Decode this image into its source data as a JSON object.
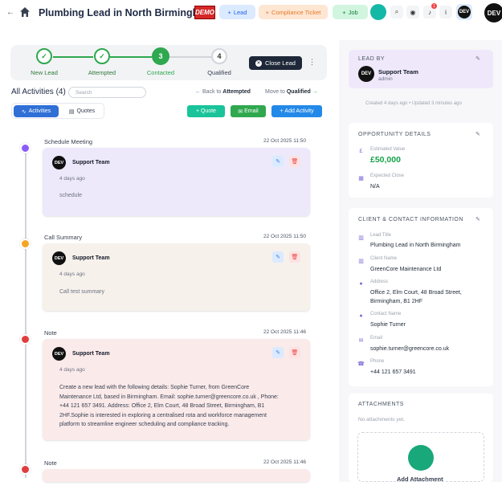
{
  "header": {
    "back_arrow": "←",
    "title": "Plumbing Lead in North Birmingh...",
    "demo_badge": "DEMO",
    "buttons": {
      "lead": "Lead",
      "compliance": "Compliance Ticket",
      "job": "Job"
    },
    "notification_count": "1",
    "avatar": "DEV"
  },
  "stepper": {
    "steps": [
      {
        "label": "New Lead",
        "state": "done"
      },
      {
        "label": "Attempted",
        "state": "done"
      },
      {
        "label": "Contacted",
        "number": "3",
        "state": "active"
      },
      {
        "label": "Qualified",
        "number": "4",
        "state": "next"
      }
    ],
    "close_lead": "Close Lead"
  },
  "activities": {
    "title": "All Activities (4)",
    "search_placeholder": "Search",
    "back_to_prefix": "Back to",
    "back_to_stage": "Attempted",
    "move_to_prefix": "Move to",
    "move_to_stage": "Qualified",
    "tabs": {
      "activities": "Activities",
      "quotes": "Quotes"
    },
    "buttons": {
      "quote": "Quote",
      "email": "Email",
      "add_activity": "Add Activity"
    },
    "items": [
      {
        "type": "Schedule Meeting",
        "date": "22 Oct 2025 11:50",
        "author": "Support Team",
        "ago": "4 days ago",
        "message": "schedule",
        "dot_color": "#8b5cf6",
        "bg": "#ede9fb"
      },
      {
        "type": "Call Summary",
        "date": "22 Oct 2025 11:50",
        "author": "Support Team",
        "ago": "4 days ago",
        "message": "Call test summary",
        "dot_color": "#f5a524",
        "bg": "#f7f1ec"
      },
      {
        "type": "Note",
        "date": "22 Oct 2025 11:46",
        "author": "Support Team",
        "ago": "4 days ago",
        "message_lines": [
          "Create a new lead with the following details: Sophie Turner, from GreenCore",
          "Maintenance Ltd, based in Birmingham. Email: sophie.turner@greencore.co.uk , Phone:",
          "+44 121 657 3491. Address: Office 2, Elm Court, 48 Broad Street, Birmingham, B1",
          "2HF.Sophie is interested in exploring a centralised rota and workforce management",
          "platform to streamline engineer scheduling and compliance tracking."
        ],
        "dot_color": "#e03e3e",
        "bg": "#fbeaea"
      },
      {
        "type": "Note",
        "date": "22 Oct 2025 11:46",
        "dot_color": "#e03e3e",
        "bg": "#fbeaea"
      }
    ]
  },
  "lead_by": {
    "title": "LEAD BY",
    "name": "Support Team",
    "role": "admin",
    "avatar": "DEV",
    "created": "Created 4 days ago • Updated 3 minutes ago"
  },
  "opportunity": {
    "title": "OPPORTUNITY DETAILS",
    "estimated_value_label": "Estimated Value",
    "estimated_value": "£50,000",
    "expected_close_label": "Expected Close",
    "expected_close": "N/A"
  },
  "client_contact": {
    "title": "CLIENT & CONTACT INFORMATION",
    "lead_title_label": "Lead Title",
    "lead_title": "Plumbing Lead in North Birmingham",
    "client_name_label": "Client Name",
    "client_name": "GreenCore Maintenance Ltd",
    "address_label": "Address",
    "address_line1": "Office 2, Elm Court, 48 Broad Street,",
    "address_line2": "Birmingham, B1 2HF",
    "contact_name_label": "Contact Name",
    "contact_name": "Sophie Turner",
    "email_label": "Email",
    "email": "sophie.turner@greencore.co.uk",
    "phone_label": "Phone",
    "phone": "+44 121 657 3491"
  },
  "attachments": {
    "title": "ATTACHMENTS",
    "empty": "No attachments yet.",
    "add": "Add Attachment"
  },
  "colors": {
    "accent_green": "#2fa84f",
    "primary_blue": "#2389e8",
    "value_green": "#16a34a"
  }
}
